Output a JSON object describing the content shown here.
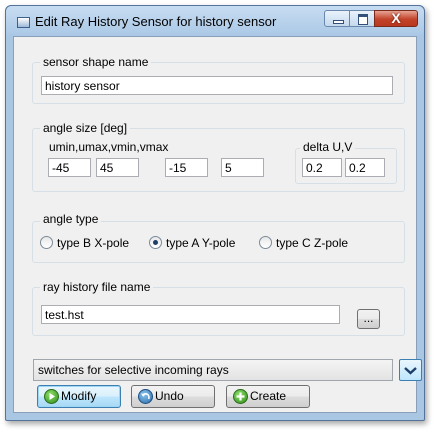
{
  "window": {
    "title": "Edit Ray History Sensor for history sensor",
    "close_glyph": "X"
  },
  "sensor_shape": {
    "label": "sensor shape name",
    "value": "history sensor"
  },
  "angle_size": {
    "label": "angle size [deg]",
    "range_label": "umin,umax,vmin,vmax",
    "range_values": [
      "-45",
      "45",
      "-15",
      "5"
    ],
    "delta_label": "delta U,V",
    "delta_values": [
      "0.2",
      "0.2"
    ]
  },
  "angle_type": {
    "label": "angle type",
    "options": [
      {
        "label": "type B X-pole",
        "selected": false
      },
      {
        "label": "type A Y-pole",
        "selected": true
      },
      {
        "label": "type C Z-pole",
        "selected": false
      }
    ]
  },
  "ray_history_file": {
    "label": "ray history file name",
    "value": "test.hst",
    "browse_label": "..."
  },
  "switches_select": {
    "value": "switches for selective incoming rays"
  },
  "buttons": {
    "modify": "Modify",
    "undo": "Undo",
    "create": "Create"
  },
  "icons": {
    "app": "window-app-icon",
    "modify": "play-icon",
    "undo": "undo-icon",
    "create": "plus-icon",
    "dropdown": "chevron-down-icon"
  }
}
